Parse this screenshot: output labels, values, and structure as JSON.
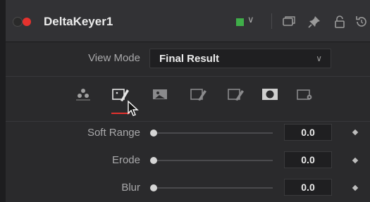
{
  "header": {
    "title": "DeltaKeyer1",
    "color_tag": "#3fae49",
    "power_color": "#e5322e",
    "chevron": "∨",
    "icons": [
      "power-toggle-icon",
      "color-tag-icon",
      "chevron-down-icon",
      "window-icon",
      "pin-icon",
      "lock-icon",
      "reset-icon"
    ]
  },
  "view_mode": {
    "label": "View Mode",
    "value": "Final Result",
    "arrow": "∨"
  },
  "tabs": [
    {
      "icon": "nodes-icon",
      "active": false
    },
    {
      "icon": "keyer-pick-icon",
      "active": true
    },
    {
      "icon": "image-icon",
      "active": false
    },
    {
      "icon": "matte-pick-icon",
      "active": false
    },
    {
      "icon": "fringe-pick-icon",
      "active": false
    },
    {
      "icon": "mask-icon",
      "active": false
    },
    {
      "icon": "settings-icon",
      "active": false
    }
  ],
  "accent_color": "#e5322e",
  "sliders": [
    {
      "label": "Soft Range",
      "value": "0.0"
    },
    {
      "label": "Erode",
      "value": "0.0"
    },
    {
      "label": "Blur",
      "value": "0.0"
    }
  ]
}
